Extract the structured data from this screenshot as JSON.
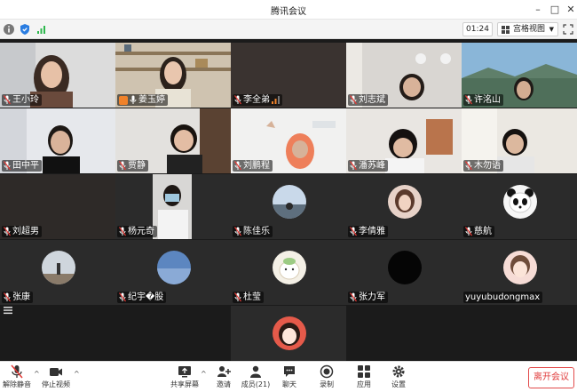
{
  "window": {
    "title": "腾讯会议"
  },
  "status": {
    "timer": "01:24",
    "view_label": "宫格视图"
  },
  "participants": [
    {
      "name": "王小玲"
    },
    {
      "name": "姜玉婷"
    },
    {
      "name": "李全弟"
    },
    {
      "name": "刘志斌"
    },
    {
      "name": "许洺山"
    },
    {
      "name": "田中平"
    },
    {
      "name": "贾静"
    },
    {
      "name": "刘鹏程"
    },
    {
      "name": "潘苏峰"
    },
    {
      "name": "木勿语"
    },
    {
      "name": "刘超男"
    },
    {
      "name": "杨元奇"
    },
    {
      "name": "陈佳乐"
    },
    {
      "name": "李倩雅"
    },
    {
      "name": "慈航"
    },
    {
      "name": "张康"
    },
    {
      "name": "纪宇�股"
    },
    {
      "name": "杜莹"
    },
    {
      "name": "张力军"
    },
    {
      "name": "yuyubudongmax"
    }
  ],
  "toolbar": {
    "unmute": "解除静音",
    "stop_video": "停止视频",
    "share": "共享屏幕",
    "invite": "邀请",
    "members": "成员(21)",
    "chat": "聊天",
    "record": "录制",
    "apps": "应用",
    "settings": "设置",
    "leave": "离开会议"
  },
  "colors": {
    "active_speaker": "#6ad13f",
    "leave": "#e03c3c",
    "host_badge": "#f0822a"
  }
}
